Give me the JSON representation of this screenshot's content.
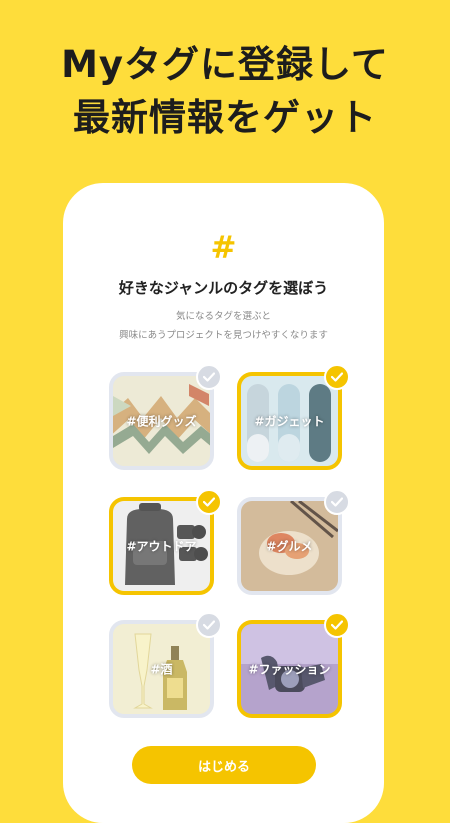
{
  "headline": {
    "line1": "Myタグに登録して",
    "line2": "最新情報をゲット"
  },
  "card": {
    "hash_symbol": "#",
    "title": "好きなジャンルのタグを選ぼう",
    "subtitle_line1": "気になるタグを選ぶと",
    "subtitle_line2": "興味にあうプロジェクトを見つけやすくなります"
  },
  "tags": [
    {
      "label": "#便利グッズ",
      "selected": false
    },
    {
      "label": "#ガジェット",
      "selected": true
    },
    {
      "label": "#アウトドア",
      "selected": true
    },
    {
      "label": "#グルメ",
      "selected": false
    },
    {
      "label": "#酒",
      "selected": false
    },
    {
      "label": "#ファッション",
      "selected": true
    }
  ],
  "start_button": "はじめる",
  "colors": {
    "background": "#fedd3b",
    "accent": "#f5c400",
    "unselected": "#e2e6ef"
  }
}
